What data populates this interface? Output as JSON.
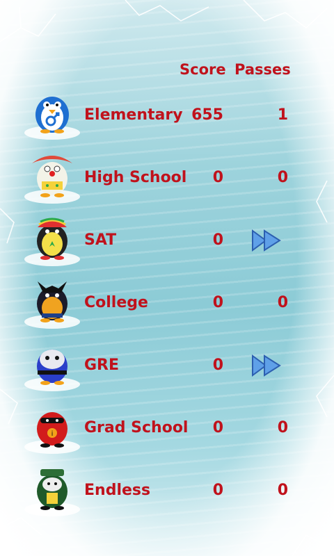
{
  "header": {
    "score_label": "Score",
    "passes_label": "Passes"
  },
  "colors": {
    "text": "#c0121c",
    "accent_blue": "#3a7fd6",
    "ice": "#9dd3dc"
  },
  "levels": [
    {
      "name": "Elementary",
      "score": "655",
      "passes": "1",
      "avatar": "penguin-male-symbol-icon"
    },
    {
      "name": "High School",
      "score": "0",
      "passes": "0",
      "avatar": "penguin-clown-icon"
    },
    {
      "name": "SAT",
      "score": "0",
      "passes": "",
      "action": "fast-forward-icon",
      "avatar": "penguin-rasta-icon"
    },
    {
      "name": "College",
      "score": "0",
      "passes": "0",
      "avatar": "penguin-wolverine-icon"
    },
    {
      "name": "GRE",
      "score": "0",
      "passes": "",
      "action": "fast-forward-icon",
      "avatar": "penguin-ninja-icon"
    },
    {
      "name": "Grad School",
      "score": "0",
      "passes": "0",
      "avatar": "penguin-incredible-icon"
    },
    {
      "name": "Endless",
      "score": "0",
      "passes": "0",
      "avatar": "penguin-officer-icon"
    }
  ]
}
